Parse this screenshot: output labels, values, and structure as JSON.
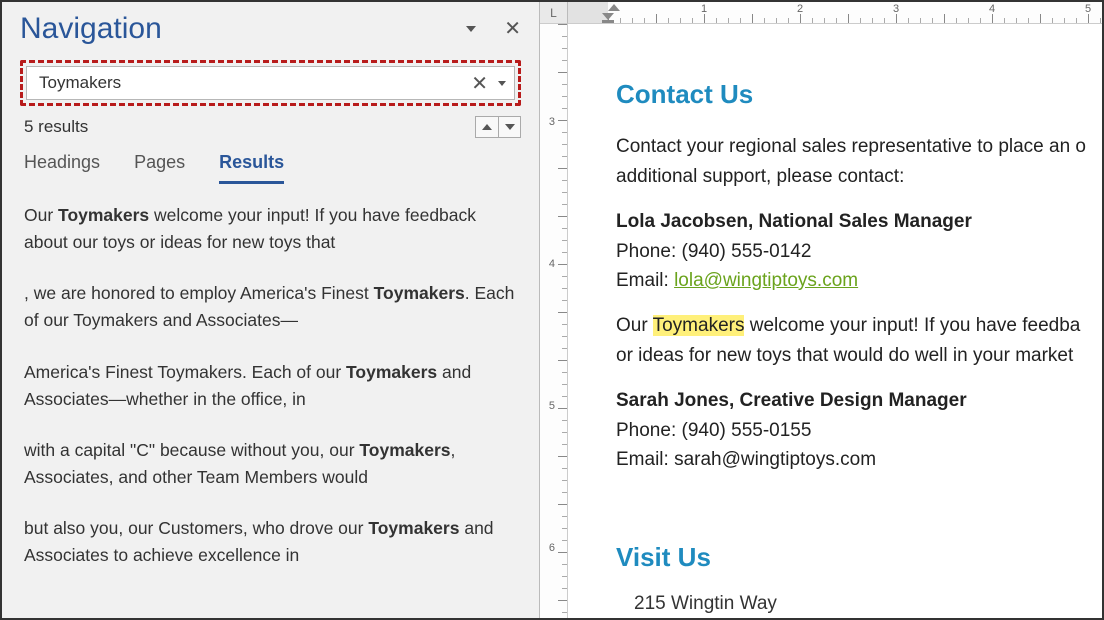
{
  "nav": {
    "title": "Navigation",
    "search_value": "Toymakers",
    "results_count": "5 results",
    "tabs": {
      "headings": "Headings",
      "pages": "Pages",
      "results": "Results"
    },
    "results": [
      {
        "pre": "Our ",
        "b": "Toymakers",
        "post": " welcome your input! If you have feedback about our toys or ideas for new toys that"
      },
      {
        "pre": ", we are honored to employ America's Finest ",
        "b": "Toymakers",
        "post": ". Each of our Toymakers and Associates—"
      },
      {
        "pre": "America's Finest Toymakers. Each of our ",
        "b": "Toymakers",
        "post": " and Associates—whether in the office, in"
      },
      {
        "pre": "with a capital \"C\" because without you, our ",
        "b": "Toymakers",
        "post": ", Associates, and other Team Members would"
      },
      {
        "pre": "but also you, our Customers, who drove our ",
        "b": "Toymakers",
        "post": " and Associates to achieve excellence in"
      }
    ]
  },
  "doc": {
    "ruler_corner": "L",
    "h_ruler_nums": [
      "1",
      "2",
      "3",
      "4",
      "5"
    ],
    "v_ruler_nums": [
      "3",
      "4",
      "5",
      "6"
    ],
    "heading_contact": "Contact Us",
    "intro_line1": "Contact your regional sales representative to place an o",
    "intro_line2": "additional support, please contact:",
    "contact1_name": "Lola Jacobsen, National Sales Manager",
    "contact1_phone": "Phone: (940) 555-0142",
    "contact1_email_label": "Email: ",
    "contact1_email": "lola@wingtiptoys.com",
    "toymakers_line_pre": "Our ",
    "toymakers_line_hl": "Toymakers",
    "toymakers_line_post": " welcome your input! If you have feedba",
    "toymakers_line2": "or ideas for new toys that would do well in your market",
    "contact2_name": "Sarah Jones, Creative Design Manager",
    "contact2_phone": "Phone: (940) 555-0155",
    "contact2_email": "Email: sarah@wingtiptoys.com",
    "heading_visit": "Visit Us",
    "address_cut": "215 Wingtin Way"
  }
}
